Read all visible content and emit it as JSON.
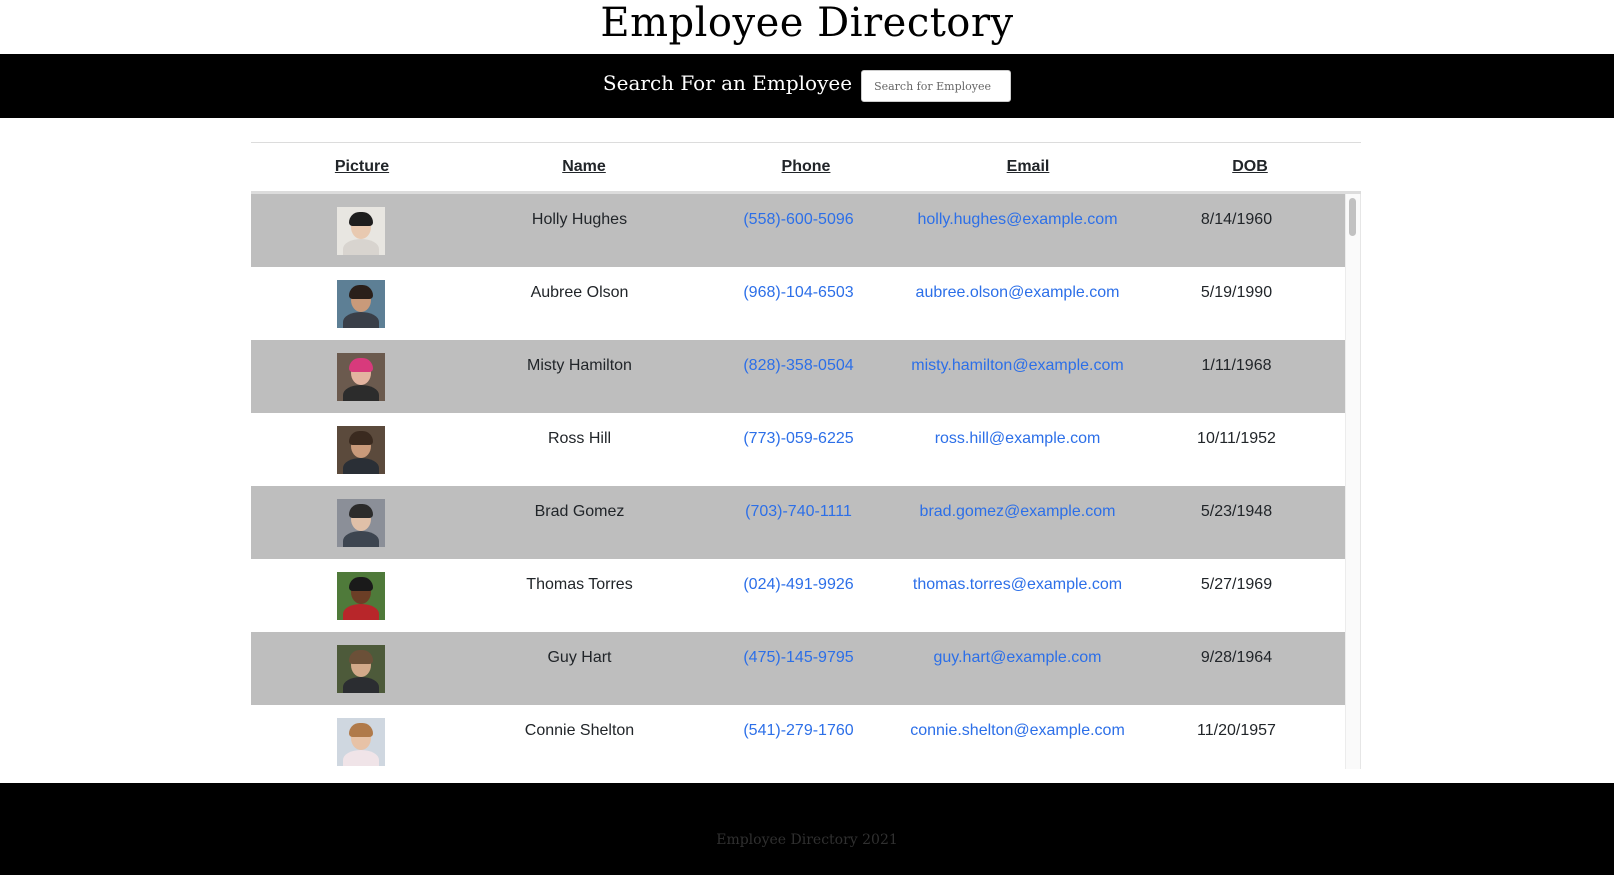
{
  "header": {
    "title": "Employee Directory"
  },
  "search": {
    "label": "Search For an Employee",
    "placeholder": "Search for Employee",
    "value": ""
  },
  "table": {
    "columns": [
      "Picture",
      "Name",
      "Phone",
      "Email",
      "DOB"
    ],
    "rows": [
      {
        "name": "Holly Hughes",
        "phone": "(558)-600-5096",
        "email": "holly.hughes@example.com",
        "dob": "8/14/1960",
        "colors": {
          "bg": "#e8e6e1",
          "skin": "#e8c9b0",
          "hair": "#1e1e1e",
          "shirt": "#d8d4cf"
        }
      },
      {
        "name": "Aubree Olson",
        "phone": "(968)-104-6503",
        "email": "aubree.olson@example.com",
        "dob": "5/19/1990",
        "colors": {
          "bg": "#5d7f95",
          "skin": "#c99a7a",
          "hair": "#2a1f1a",
          "shirt": "#3a3f48"
        }
      },
      {
        "name": "Misty Hamilton",
        "phone": "(828)-358-0504",
        "email": "misty.hamilton@example.com",
        "dob": "1/11/1968",
        "colors": {
          "bg": "#6b5a4e",
          "skin": "#e3b4a0",
          "hair": "#d83a7c",
          "shirt": "#2c2c2c"
        }
      },
      {
        "name": "Ross Hill",
        "phone": "(773)-059-6225",
        "email": "ross.hill@example.com",
        "dob": "10/11/1952",
        "colors": {
          "bg": "#5b4a3c",
          "skin": "#c99a7a",
          "hair": "#3a2a1f",
          "shirt": "#2a2f36"
        }
      },
      {
        "name": "Brad Gomez",
        "phone": "(703)-740-1111",
        "email": "brad.gomez@example.com",
        "dob": "5/23/1948",
        "colors": {
          "bg": "#8b8f98",
          "skin": "#e0c0a8",
          "hair": "#2b2b2b",
          "shirt": "#3d4550"
        }
      },
      {
        "name": "Thomas Torres",
        "phone": "(024)-491-9926",
        "email": "thomas.torres@example.com",
        "dob": "5/27/1969",
        "colors": {
          "bg": "#4f7a3a",
          "skin": "#6b3e26",
          "hair": "#1a1a1a",
          "shirt": "#b8262a"
        }
      },
      {
        "name": "Guy Hart",
        "phone": "(475)-145-9795",
        "email": "guy.hart@example.com",
        "dob": "9/28/1964",
        "colors": {
          "bg": "#4d5a3a",
          "skin": "#d2a98a",
          "hair": "#6b5038",
          "shirt": "#2b2d31"
        }
      },
      {
        "name": "Connie Shelton",
        "phone": "(541)-279-1760",
        "email": "connie.shelton@example.com",
        "dob": "11/20/1957",
        "colors": {
          "bg": "#cfd7e0",
          "skin": "#e7c2a6",
          "hair": "#b07a4a",
          "shirt": "#f0e4e8"
        }
      }
    ]
  },
  "footer": {
    "text": "Employee Directory 2021"
  }
}
